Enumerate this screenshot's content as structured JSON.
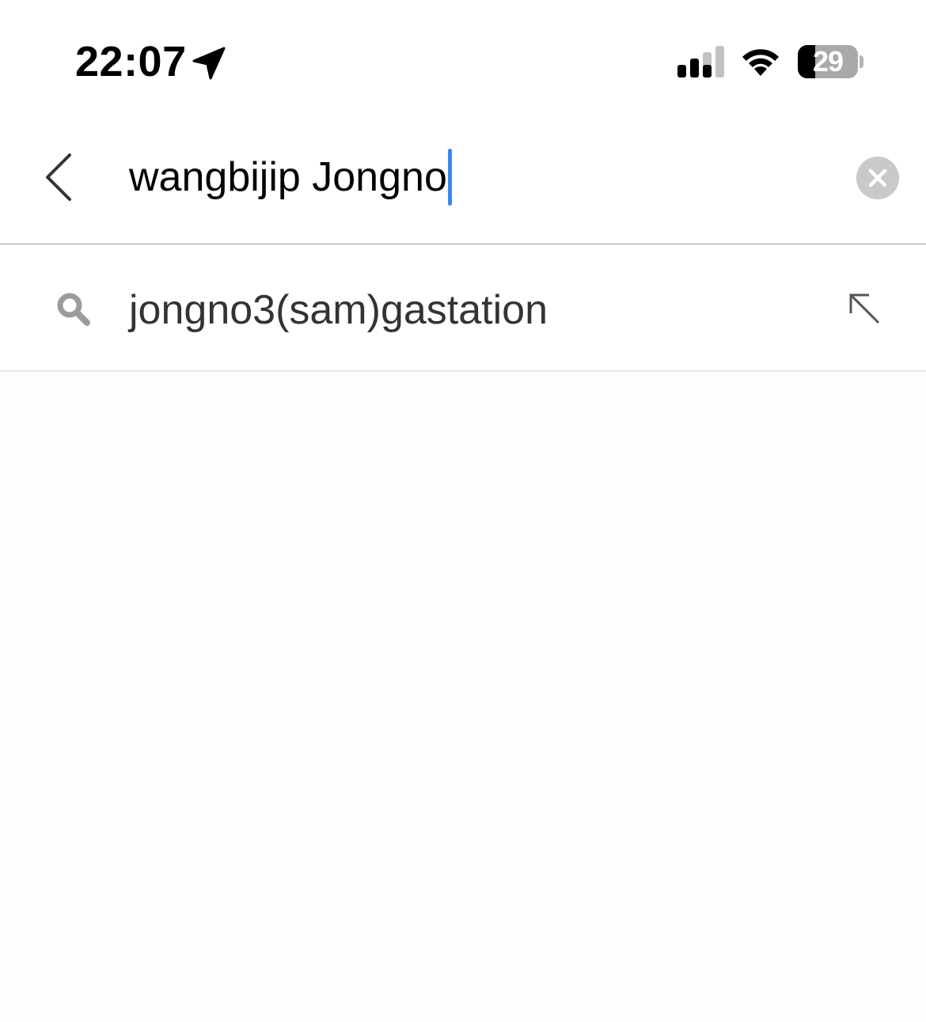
{
  "status_bar": {
    "time": "22:07",
    "battery_percent": "29",
    "icons": [
      "location-arrow-icon",
      "cellular-signal-icon",
      "wifi-icon",
      "battery-icon"
    ]
  },
  "search": {
    "query": "wangbijip Jongno",
    "icons": [
      "back-chevron-icon",
      "clear-circle-x-icon"
    ],
    "colors": {
      "caret": "#3a86f0",
      "clear_button": "#c9c9c9"
    }
  },
  "suggestions": [
    {
      "text": "jongno3(sam)gastation",
      "icon": "search-icon",
      "action_icon": "arrow-up-left-icon"
    }
  ]
}
